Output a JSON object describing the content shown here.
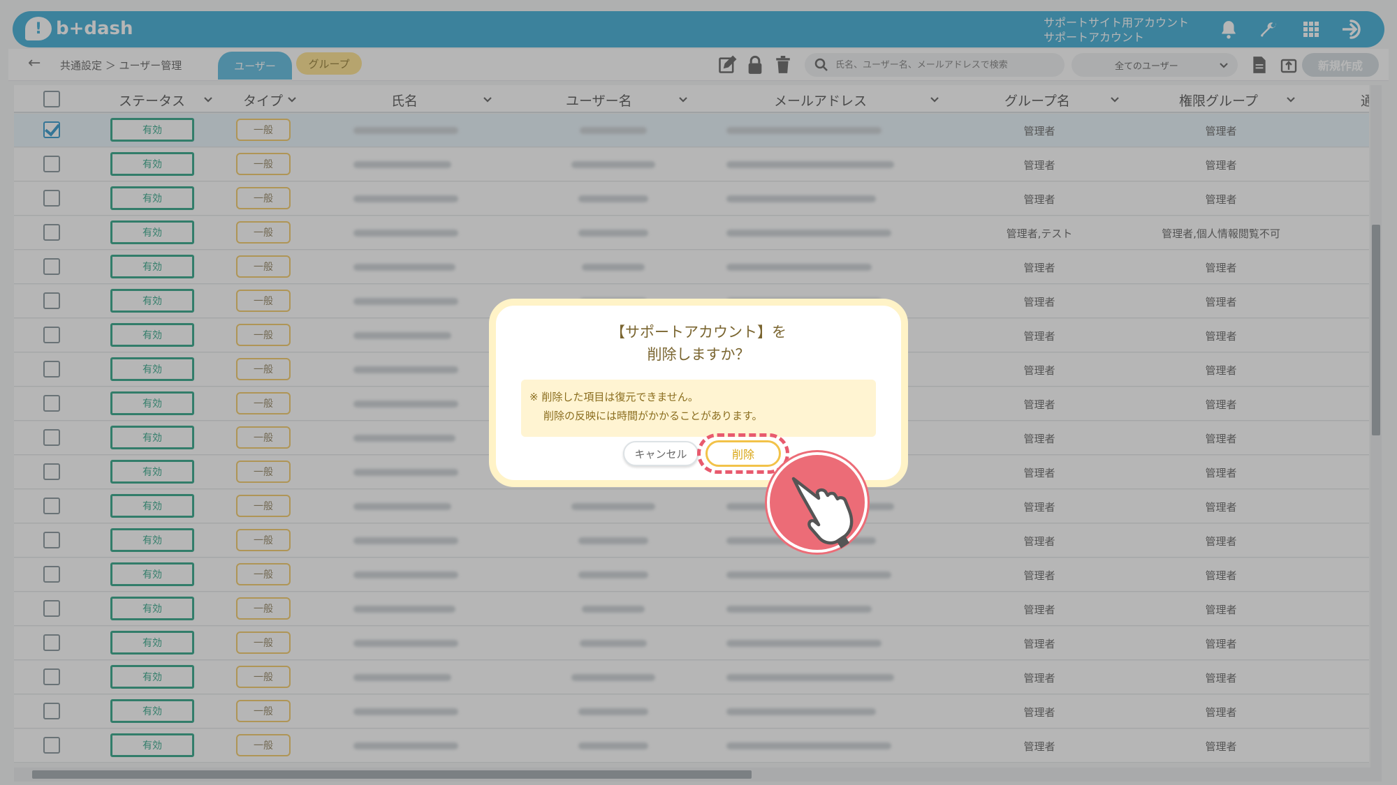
{
  "header": {
    "logo_text": "b+dash",
    "account_line1": "サポートサイト用アカウント",
    "account_line2": "サポートアカウント",
    "icons": [
      "bell-icon",
      "wrench-icon",
      "grid-icon",
      "logout-icon"
    ]
  },
  "toolbar": {
    "back_glyph": "←",
    "breadcrumb": "共通設定 ＞ ユーザー管理",
    "tab_user": "ユーザー",
    "tab_group": "グループ",
    "search_placeholder": "氏名、ユーザー名、メールアドレスで検索",
    "filter_value": "全てのユーザー",
    "new_button": "新規作成"
  },
  "table": {
    "columns": {
      "status": "ステータス",
      "type": "タイプ",
      "name": "氏名",
      "username": "ユーザー名",
      "email": "メールアドレス",
      "group": "グループ名",
      "permission": "権限グループ",
      "more": "通"
    },
    "rows": [
      {
        "status": "有効",
        "type": "一般",
        "group": "管理者",
        "permission": "管理者",
        "selected": true
      },
      {
        "status": "有効",
        "type": "一般",
        "group": "管理者",
        "permission": "管理者"
      },
      {
        "status": "有効",
        "type": "一般",
        "group": "管理者",
        "permission": "管理者"
      },
      {
        "status": "有効",
        "type": "一般",
        "group": "管理者,テスト",
        "permission": "管理者,個人情報閲覧不可"
      },
      {
        "status": "有効",
        "type": "一般",
        "group": "管理者",
        "permission": "管理者"
      },
      {
        "status": "有効",
        "type": "一般",
        "group": "管理者",
        "permission": "管理者"
      },
      {
        "status": "有効",
        "type": "一般",
        "group": "管理者",
        "permission": "管理者"
      },
      {
        "status": "有効",
        "type": "一般",
        "group": "管理者",
        "permission": "管理者"
      },
      {
        "status": "有効",
        "type": "一般",
        "group": "管理者",
        "permission": "管理者"
      },
      {
        "status": "有効",
        "type": "一般",
        "group": "管理者",
        "permission": "管理者"
      },
      {
        "status": "有効",
        "type": "一般",
        "group": "管理者",
        "permission": "管理者"
      },
      {
        "status": "有効",
        "type": "一般",
        "group": "管理者",
        "permission": "管理者"
      },
      {
        "status": "有効",
        "type": "一般",
        "group": "管理者",
        "permission": "管理者"
      },
      {
        "status": "有効",
        "type": "一般",
        "group": "管理者",
        "permission": "管理者"
      },
      {
        "status": "有効",
        "type": "一般",
        "group": "管理者",
        "permission": "管理者"
      },
      {
        "status": "有効",
        "type": "一般",
        "group": "管理者",
        "permission": "管理者"
      },
      {
        "status": "有効",
        "type": "一般",
        "group": "管理者",
        "permission": "管理者"
      },
      {
        "status": "有効",
        "type": "一般",
        "group": "管理者",
        "permission": "管理者"
      },
      {
        "status": "有効",
        "type": "一般",
        "group": "管理者",
        "permission": "管理者"
      }
    ]
  },
  "modal": {
    "title_line1": "【サポートアカウント】を",
    "title_line2": "削除しますか？",
    "note_line1": "※ 削除した項目は復元できません。",
    "note_line2": "削除の反映には時間がかかることがあります。",
    "cancel": "キャンセル",
    "delete": "削除"
  }
}
